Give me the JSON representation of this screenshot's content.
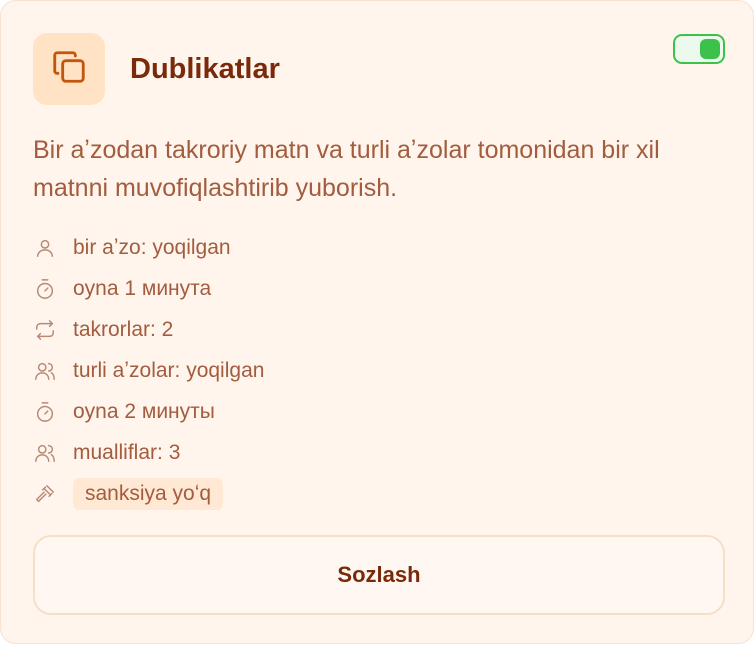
{
  "card": {
    "title": "Dublikatlar",
    "toggle_enabled": true,
    "icon": "copy-icon",
    "description": "Bir aʼzodan takroriy matn va turli aʼzolar tomonidan bir xil matnni muvofiqlashtirib yuborish.",
    "meta": [
      {
        "icon": "user-icon",
        "text": "bir aʼzo: yoqilgan"
      },
      {
        "icon": "timer-icon",
        "text": "oyna 1 минута"
      },
      {
        "icon": "repeat-icon",
        "text": "takrorlar: 2"
      },
      {
        "icon": "users-icon",
        "text": "turli aʼzolar: yoqilgan"
      },
      {
        "icon": "timer-icon",
        "text": "oyna 2 минуты"
      },
      {
        "icon": "users-icon",
        "text": "mualliflar: 3"
      },
      {
        "icon": "gavel-icon",
        "text": "sanksiya yoʻq"
      }
    ],
    "button_label": "Sozlash"
  },
  "colors": {
    "card_bg": "#fff5ec",
    "title": "#7a2a0b",
    "text": "#a35c3e",
    "accent_bg": "#ffe3c4",
    "icon": "#c2560f",
    "toggle": "#3cc24a"
  }
}
